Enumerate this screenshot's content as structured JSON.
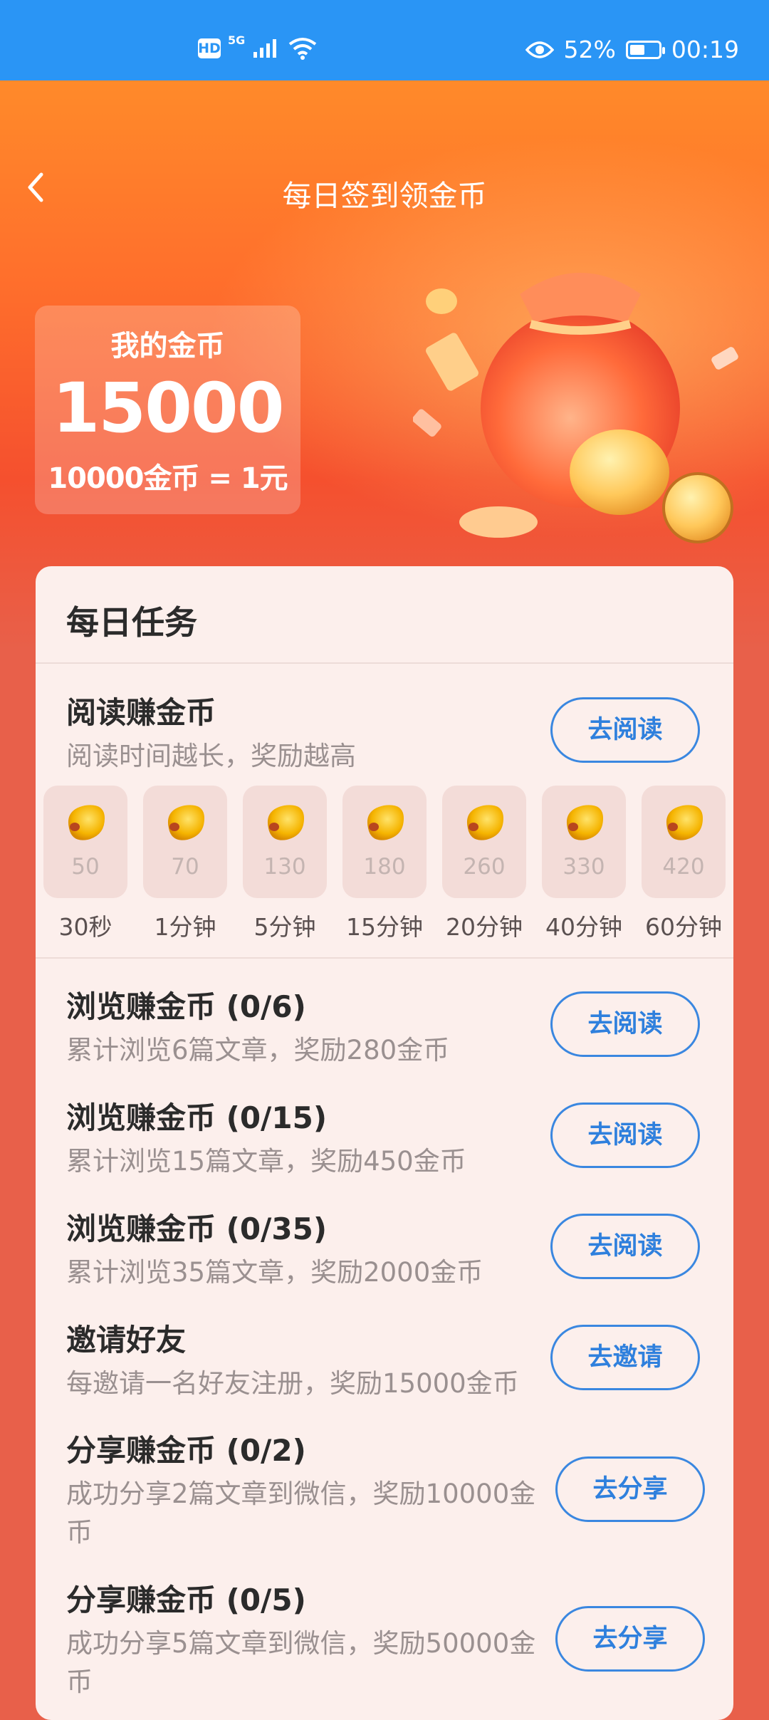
{
  "status_bar": {
    "hd": "HD",
    "network": "5G",
    "battery_percent": "52%",
    "battery_level": 0.52,
    "time": "00:19"
  },
  "header": {
    "title": "每日签到领金币"
  },
  "coins": {
    "label": "我的金币",
    "amount": "15000",
    "rate": "10000金币 = 1元"
  },
  "panel": {
    "title": "每日任务",
    "reading": {
      "title": "阅读赚金币",
      "desc": "阅读时间越长，奖励越高",
      "button": "去阅读",
      "steps": [
        {
          "value": "50",
          "time": "30秒"
        },
        {
          "value": "70",
          "time": "1分钟"
        },
        {
          "value": "130",
          "time": "5分钟"
        },
        {
          "value": "180",
          "time": "15分钟"
        },
        {
          "value": "260",
          "time": "20分钟"
        },
        {
          "value": "330",
          "time": "40分钟"
        },
        {
          "value": "420",
          "time": "60分钟"
        }
      ]
    },
    "tasks": [
      {
        "title": "浏览赚金币 (0/6)",
        "desc": "累计浏览6篇文章，奖励280金币",
        "button": "去阅读"
      },
      {
        "title": "浏览赚金币 (0/15)",
        "desc": "累计浏览15篇文章，奖励450金币",
        "button": "去阅读"
      },
      {
        "title": "浏览赚金币 (0/35)",
        "desc": "累计浏览35篇文章，奖励2000金币",
        "button": "去阅读"
      },
      {
        "title": "邀请好友",
        "desc": "每邀请一名好友注册，奖励15000金币",
        "button": "去邀请"
      },
      {
        "title": "分享赚金币 (0/2)",
        "desc": "成功分享2篇文章到微信，奖励10000金币",
        "button": "去分享"
      },
      {
        "title": "分享赚金币 (0/5)",
        "desc": "成功分享5篇文章到微信，奖励50000金币",
        "button": "去分享"
      }
    ]
  },
  "colors": {
    "status_bar": "#2a95f5",
    "hero_orange": "#ff8a2a",
    "panel_bg": "#fcefec",
    "button_blue": "#2f80dd",
    "coin_gold": "#f5b400"
  },
  "icons": [
    "hd-icon",
    "signal-icon",
    "wifi-icon",
    "eye-icon",
    "battery-icon",
    "back-chevron-icon",
    "money-bag-illustration",
    "gold-bean-icon"
  ]
}
